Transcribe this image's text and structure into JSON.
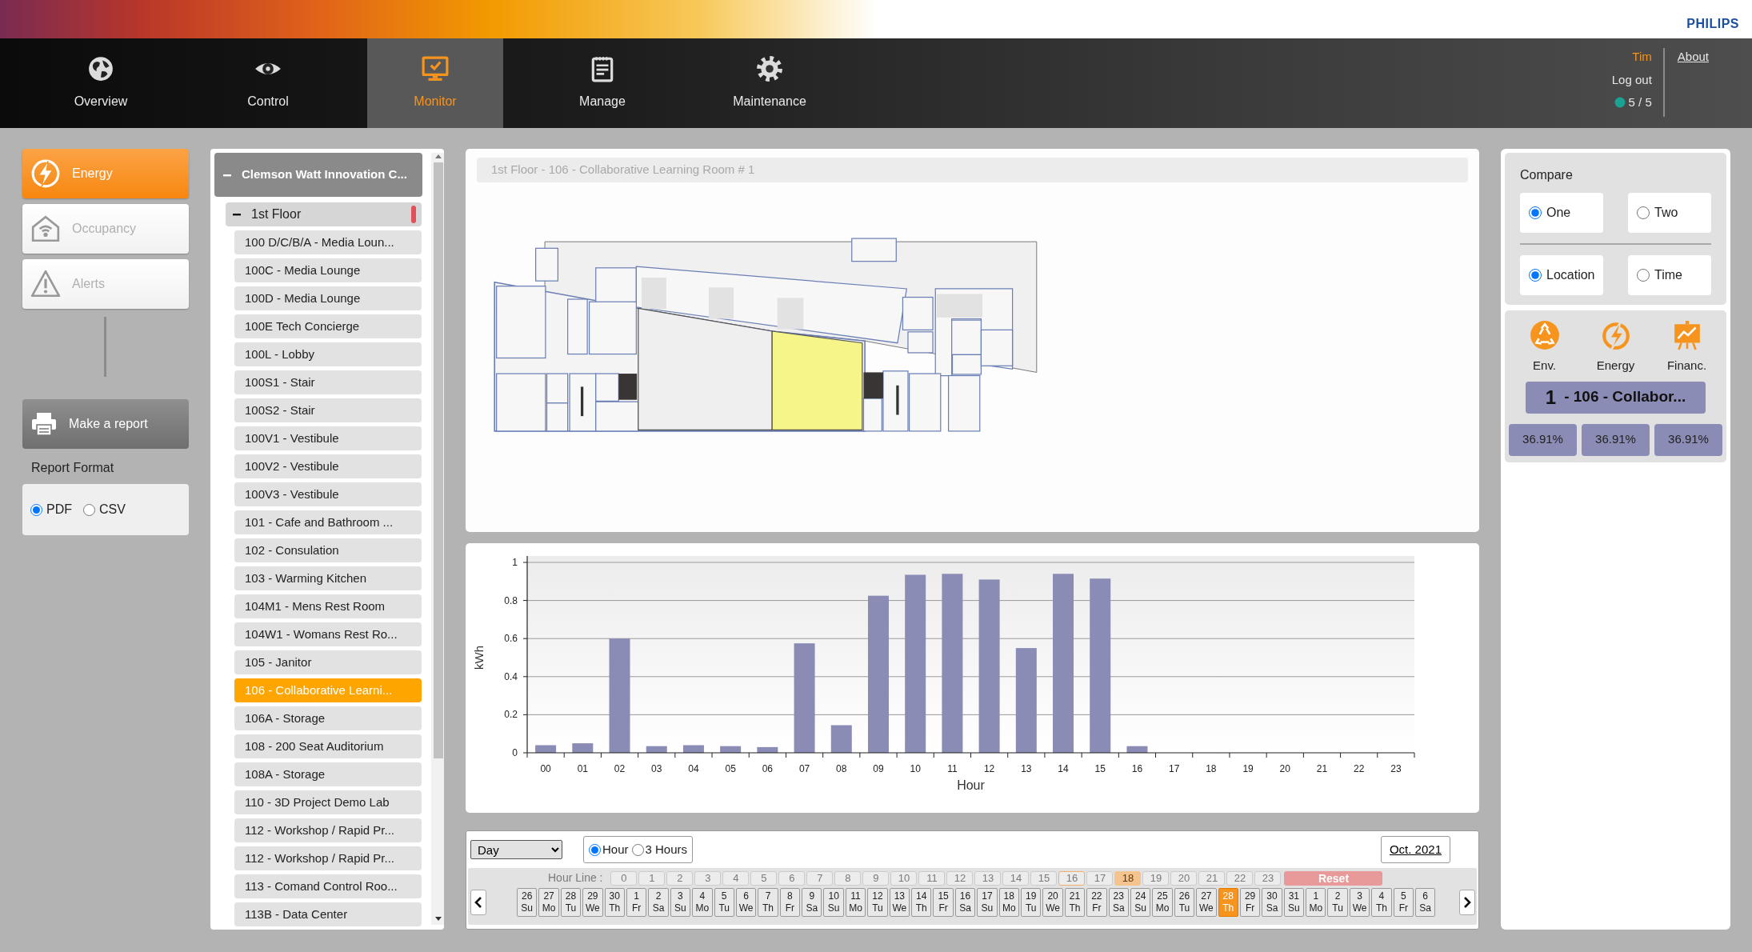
{
  "header": {
    "brand": "PHILIPS"
  },
  "nav": {
    "tabs": [
      {
        "label": "Overview",
        "selected": false
      },
      {
        "label": "Control",
        "selected": false
      },
      {
        "label": "Monitor",
        "selected": true
      },
      {
        "label": "Manage",
        "selected": false
      },
      {
        "label": "Maintenance",
        "selected": false
      }
    ]
  },
  "user": {
    "name": "Tim",
    "logout": "Log out",
    "status": "5 / 5",
    "about": "About"
  },
  "modes": [
    {
      "label": "Energy",
      "selected": true
    },
    {
      "label": "Occupancy",
      "selected": false
    },
    {
      "label": "Alerts",
      "selected": false
    }
  ],
  "report": {
    "button": "Make a report",
    "format_label": "Report Format",
    "formats": [
      {
        "label": "PDF",
        "selected": true
      },
      {
        "label": "CSV",
        "selected": false
      }
    ]
  },
  "tree": {
    "label": "Clemson Watt Innovation C...",
    "expanded": true,
    "children": [
      {
        "label": "1st Floor",
        "expanded": true,
        "children": [
          {
            "label": "100 D/C/B/A - Media Loun...",
            "selected": false
          },
          {
            "label": "100C - Media Lounge",
            "selected": false
          },
          {
            "label": "100D - Media Lounge",
            "selected": false
          },
          {
            "label": "100E Tech Concierge",
            "selected": false
          },
          {
            "label": "100L - Lobby",
            "selected": false
          },
          {
            "label": "100S1 - Stair",
            "selected": false
          },
          {
            "label": "100S2 - Stair",
            "selected": false
          },
          {
            "label": "100V1 - Vestibule",
            "selected": false
          },
          {
            "label": "100V2 - Vestibule",
            "selected": false
          },
          {
            "label": "100V3 - Vestibule",
            "selected": false
          },
          {
            "label": "101 - Cafe and Bathroom ...",
            "selected": false
          },
          {
            "label": "102 - Consulation",
            "selected": false
          },
          {
            "label": "103 - Warming Kitchen",
            "selected": false
          },
          {
            "label": "104M1 - Mens Rest Room",
            "selected": false
          },
          {
            "label": "104W1 - Womans Rest Ro...",
            "selected": false
          },
          {
            "label": "105 - Janitor",
            "selected": false
          },
          {
            "label": "106 - Collaborative Learni...",
            "selected": true
          },
          {
            "label": "106A - Storage",
            "selected": false
          },
          {
            "label": "108 - 200 Seat Auditorium",
            "selected": false
          },
          {
            "label": "108A - Storage",
            "selected": false
          },
          {
            "label": "110 - 3D Project Demo Lab",
            "selected": false
          },
          {
            "label": "112 - Workshop / Rapid Pr...",
            "selected": false
          },
          {
            "label": "112 - Workshop / Rapid Pr...",
            "selected": false
          },
          {
            "label": "113 - Comand Control Roo...",
            "selected": false
          },
          {
            "label": "113B - Data Center",
            "selected": false
          }
        ]
      }
    ]
  },
  "floor_plan": {
    "title": "1st Floor - 106 - Collaborative Learning Room # 1"
  },
  "chart": {
    "chart_data": {
      "type": "bar",
      "xlabel": "Hour",
      "ylabel": "kWh",
      "categories": [
        "00",
        "01",
        "02",
        "03",
        "04",
        "05",
        "06",
        "07",
        "08",
        "09",
        "10",
        "11",
        "12",
        "13",
        "14",
        "15",
        "16",
        "17",
        "18",
        "19",
        "20",
        "21",
        "22",
        "23"
      ],
      "series": [
        {
          "color": "#8b8cb5",
          "values": [
            0.04,
            0.05,
            0.6,
            0.035,
            0.04,
            0.035,
            0.03,
            0.575,
            0.145,
            0.825,
            0.935,
            0.94,
            0.91,
            0.55,
            0.94,
            0.915,
            0.035,
            0,
            0,
            0,
            0,
            0,
            0,
            0
          ]
        }
      ],
      "ylim": [
        0,
        1
      ],
      "yticks": [
        0,
        0.2,
        0.4,
        0.6,
        0.8,
        1
      ],
      "grid": true
    }
  },
  "timeline": {
    "period": "Day",
    "resolutions": [
      {
        "label": "Hour",
        "selected": true
      },
      {
        "label": "3 Hours",
        "selected": false
      }
    ],
    "month": "Oct. 2021",
    "hour_line_label": "Hour Line :",
    "reset": "Reset",
    "hours": [
      {
        "label": "0",
        "selected": false,
        "current": false
      },
      {
        "label": "1",
        "selected": false,
        "current": false
      },
      {
        "label": "2",
        "selected": false,
        "current": false
      },
      {
        "label": "3",
        "selected": false,
        "current": false
      },
      {
        "label": "4",
        "selected": false,
        "current": false
      },
      {
        "label": "5",
        "selected": false,
        "current": false
      },
      {
        "label": "6",
        "selected": false,
        "current": false
      },
      {
        "label": "7",
        "selected": false,
        "current": false
      },
      {
        "label": "8",
        "selected": false,
        "current": false
      },
      {
        "label": "9",
        "selected": false,
        "current": false
      },
      {
        "label": "10",
        "selected": false,
        "current": false
      },
      {
        "label": "11",
        "selected": false,
        "current": false
      },
      {
        "label": "12",
        "selected": false,
        "current": false
      },
      {
        "label": "13",
        "selected": false,
        "current": false
      },
      {
        "label": "14",
        "selected": false,
        "current": false
      },
      {
        "label": "15",
        "selected": false,
        "current": false
      },
      {
        "label": "16",
        "selected": false,
        "current": true
      },
      {
        "label": "17",
        "selected": false,
        "current": false
      },
      {
        "label": "18",
        "selected": true,
        "current": false
      },
      {
        "label": "19",
        "selected": false,
        "current": false
      },
      {
        "label": "20",
        "selected": false,
        "current": false
      },
      {
        "label": "21",
        "selected": false,
        "current": false
      },
      {
        "label": "22",
        "selected": false,
        "current": false
      },
      {
        "label": "23",
        "selected": false,
        "current": false
      }
    ],
    "days": [
      {
        "date": "26",
        "weekday": "Su",
        "selected": false
      },
      {
        "date": "27",
        "weekday": "Mo",
        "selected": false
      },
      {
        "date": "28",
        "weekday": "Tu",
        "selected": false
      },
      {
        "date": "29",
        "weekday": "We",
        "selected": false
      },
      {
        "date": "30",
        "weekday": "Th",
        "selected": false
      },
      {
        "date": "1",
        "weekday": "Fr",
        "selected": false
      },
      {
        "date": "2",
        "weekday": "Sa",
        "selected": false
      },
      {
        "date": "3",
        "weekday": "Su",
        "selected": false
      },
      {
        "date": "4",
        "weekday": "Mo",
        "selected": false
      },
      {
        "date": "5",
        "weekday": "Tu",
        "selected": false
      },
      {
        "date": "6",
        "weekday": "We",
        "selected": false
      },
      {
        "date": "7",
        "weekday": "Th",
        "selected": false
      },
      {
        "date": "8",
        "weekday": "Fr",
        "selected": false
      },
      {
        "date": "9",
        "weekday": "Sa",
        "selected": false
      },
      {
        "date": "10",
        "weekday": "Su",
        "selected": false
      },
      {
        "date": "11",
        "weekday": "Mo",
        "selected": false
      },
      {
        "date": "12",
        "weekday": "Tu",
        "selected": false
      },
      {
        "date": "13",
        "weekday": "We",
        "selected": false
      },
      {
        "date": "14",
        "weekday": "Th",
        "selected": false
      },
      {
        "date": "15",
        "weekday": "Fr",
        "selected": false
      },
      {
        "date": "16",
        "weekday": "Sa",
        "selected": false
      },
      {
        "date": "17",
        "weekday": "Su",
        "selected": false
      },
      {
        "date": "18",
        "weekday": "Mo",
        "selected": false
      },
      {
        "date": "19",
        "weekday": "Tu",
        "selected": false
      },
      {
        "date": "20",
        "weekday": "We",
        "selected": false
      },
      {
        "date": "21",
        "weekday": "Th",
        "selected": false
      },
      {
        "date": "22",
        "weekday": "Fr",
        "selected": false
      },
      {
        "date": "23",
        "weekday": "Sa",
        "selected": false
      },
      {
        "date": "24",
        "weekday": "Su",
        "selected": false
      },
      {
        "date": "25",
        "weekday": "Mo",
        "selected": false
      },
      {
        "date": "26",
        "weekday": "Tu",
        "selected": false
      },
      {
        "date": "27",
        "weekday": "We",
        "selected": false
      },
      {
        "date": "28",
        "weekday": "Th",
        "selected": true
      },
      {
        "date": "29",
        "weekday": "Fr",
        "selected": false
      },
      {
        "date": "30",
        "weekday": "Sa",
        "selected": false
      },
      {
        "date": "31",
        "weekday": "Su",
        "selected": false
      },
      {
        "date": "1",
        "weekday": "Mo",
        "selected": false
      },
      {
        "date": "2",
        "weekday": "Tu",
        "selected": false
      },
      {
        "date": "3",
        "weekday": "We",
        "selected": false
      },
      {
        "date": "4",
        "weekday": "Th",
        "selected": false
      },
      {
        "date": "5",
        "weekday": "Fr",
        "selected": false
      },
      {
        "date": "6",
        "weekday": "Sa",
        "selected": false
      }
    ]
  },
  "compare": {
    "title": "Compare",
    "count": [
      {
        "label": "One",
        "selected": true
      },
      {
        "label": "Two",
        "selected": false
      }
    ],
    "mode": [
      {
        "label": "Location",
        "selected": true
      },
      {
        "label": "Time",
        "selected": false
      }
    ]
  },
  "metrics": {
    "categories": [
      {
        "label": "Env."
      },
      {
        "label": "Energy"
      },
      {
        "label": "Financ."
      }
    ],
    "location": {
      "index": "1",
      "name": "- 106 - Collabor..."
    },
    "values": [
      "36.91%",
      "36.91%",
      "36.91%"
    ]
  }
}
